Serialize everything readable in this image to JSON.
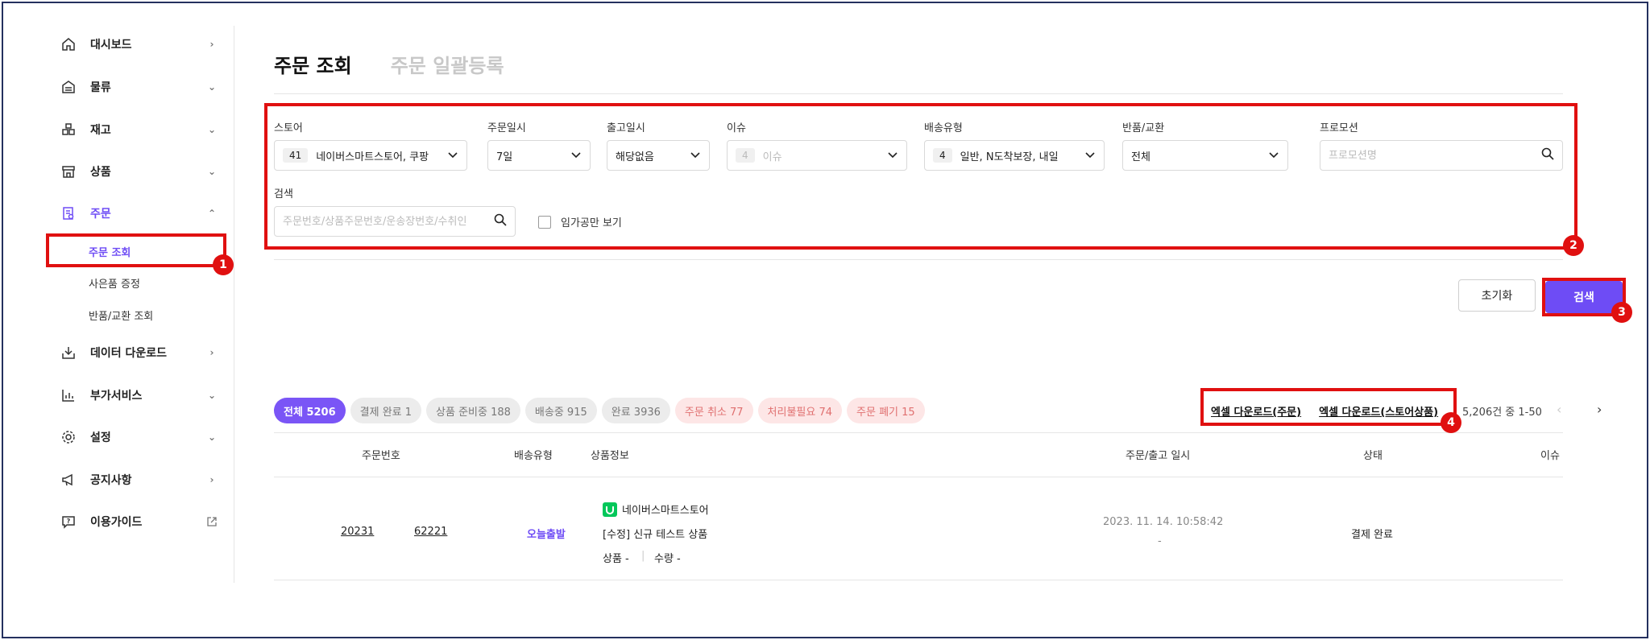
{
  "sidebar": {
    "items": [
      {
        "label": "대시보드",
        "icon": "home-icon",
        "chev": "›"
      },
      {
        "label": "물류",
        "icon": "warehouse-icon",
        "chev": "⌄"
      },
      {
        "label": "재고",
        "icon": "boxes-icon",
        "chev": "⌄"
      },
      {
        "label": "상품",
        "icon": "store-icon",
        "chev": "⌄"
      },
      {
        "label": "주문",
        "icon": "order-icon",
        "chev": "⌃"
      },
      {
        "label": "데이터 다운로드",
        "icon": "download-icon",
        "chev": "›"
      },
      {
        "label": "부가서비스",
        "icon": "chart-icon",
        "chev": "⌄"
      },
      {
        "label": "설정",
        "icon": "gear-icon",
        "chev": "⌄"
      },
      {
        "label": "공지사항",
        "icon": "megaphone-icon",
        "chev": "›"
      },
      {
        "label": "이용가이드",
        "icon": "help-icon",
        "chev": "external-link-icon"
      }
    ],
    "sub_items": [
      {
        "label": "주문 조회"
      },
      {
        "label": "사은품 증정"
      },
      {
        "label": "반품/교환 조회"
      }
    ]
  },
  "tabs": {
    "active": "주문 조회",
    "inactive": "주문 일괄등록"
  },
  "filters": {
    "store": {
      "label": "스토어",
      "count": "41",
      "value": "네이버스마트스토어, 쿠팡"
    },
    "order_date": {
      "label": "주문일시",
      "value": "7일"
    },
    "ship_date": {
      "label": "출고일시",
      "value": "해당없음"
    },
    "issue": {
      "label": "이슈",
      "count": "4",
      "value": "이슈"
    },
    "delivery": {
      "label": "배송유형",
      "count": "4",
      "value": "일반, N도착보장, 내일"
    },
    "return": {
      "label": "반품/교환",
      "value": "전체"
    },
    "promotion": {
      "label": "프로모션",
      "placeholder": "프로모션명"
    },
    "search": {
      "label": "검색",
      "placeholder": "주문번호/상품주문번호/운송장번호/수취인"
    },
    "temp_only": {
      "label": "임가공만 보기"
    }
  },
  "buttons": {
    "reset": "초기화",
    "search": "검색"
  },
  "status_chips": [
    {
      "label": "전체 5206",
      "style": "active"
    },
    {
      "label": "결제 완료 1",
      "style": "gray"
    },
    {
      "label": "상품 준비중 188",
      "style": "gray"
    },
    {
      "label": "배송중 915",
      "style": "gray"
    },
    {
      "label": "완료 3936",
      "style": "gray"
    },
    {
      "label": "주문 취소 77",
      "style": "red"
    },
    {
      "label": "처리불필요 74",
      "style": "red"
    },
    {
      "label": "주문 폐기 15",
      "style": "red"
    }
  ],
  "downloads": {
    "order": "엑셀 다운로드(주문)",
    "store_product": "엑셀 다운로드(스토어상품)"
  },
  "pagination": {
    "info": "5,206건 중 1-50",
    "prev": "‹",
    "next": "›"
  },
  "table": {
    "headers": [
      "주문번호",
      "배송유형",
      "상품정보",
      "주문/출고 일시",
      "상태",
      "이슈"
    ],
    "rows": [
      {
        "order_no_1": "20231",
        "order_no_2": "62221",
        "delivery": "오늘출발",
        "store_name": "네이버스마트스토어",
        "product_name": "[수정] 신규 테스트 상품",
        "product_label": "상품 -",
        "qty_label": "수량 -",
        "order_datetime": "2023. 11. 14. 10:58:42",
        "ship_datetime": "-",
        "status": "결제 완료"
      }
    ]
  },
  "annotations": [
    "1",
    "2",
    "3",
    "4"
  ],
  "colors": {
    "accent": "#6e4cf5",
    "annotation": "#e01010",
    "frame": "#24305e",
    "naver_green": "#03c75a"
  }
}
